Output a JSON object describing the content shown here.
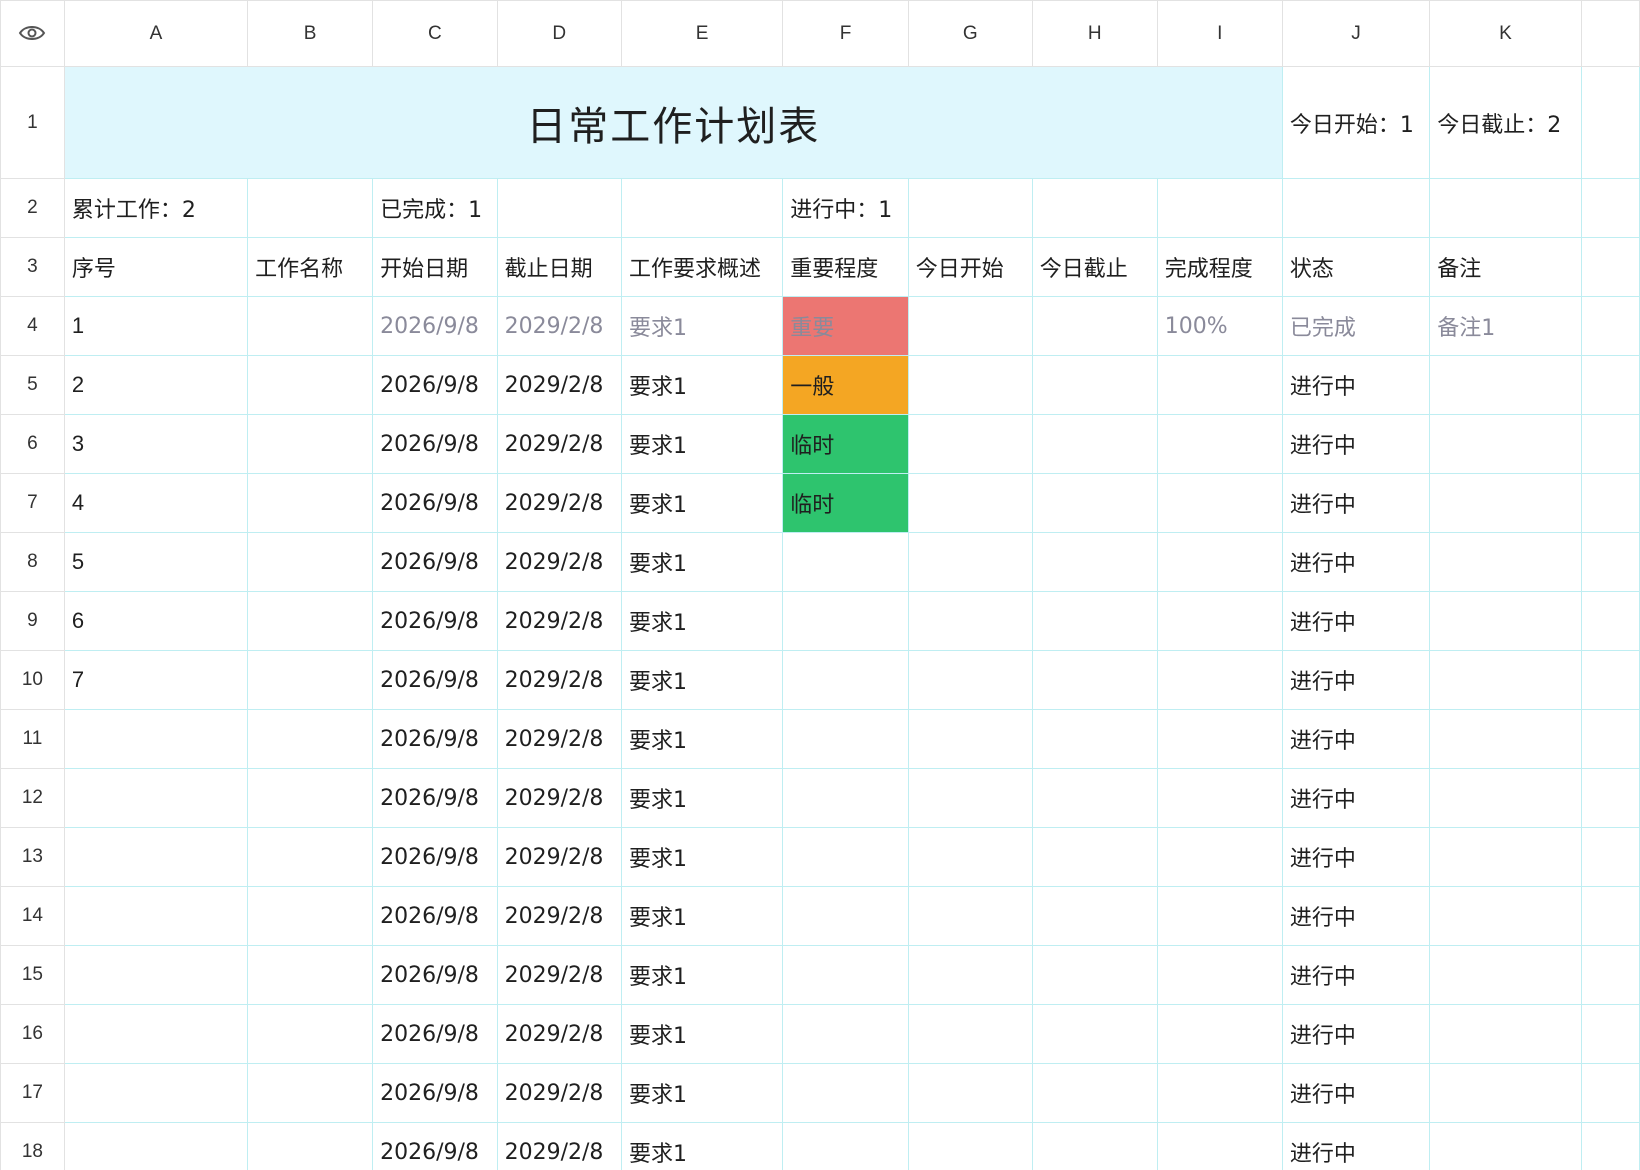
{
  "columns": [
    "A",
    "B",
    "C",
    "D",
    "E",
    "F",
    "G",
    "H",
    "I",
    "J",
    "K"
  ],
  "title": "日常工作计划表",
  "today_start": "今日开始：1",
  "today_due": "今日截止：2",
  "summary": {
    "total": "累计工作：2",
    "done": "已完成：1",
    "in_progress": "进行中：1"
  },
  "headers": [
    "序号",
    "工作名称",
    "开始日期",
    "截止日期",
    "工作要求概述",
    "重要程度",
    "今日开始",
    "今日截止",
    "完成程度",
    "状态",
    "备注"
  ],
  "colors": {
    "important": "#ec7672",
    "normal": "#f4a623",
    "temporary": "#2ec46e",
    "title_bg": "#dff7fd",
    "grid": "#bfeef2"
  },
  "rows": [
    {
      "n": "4",
      "seq": "1",
      "start": "2026/9/8",
      "due": "2029/2/8",
      "req": "要求1",
      "level": "重要",
      "level_color": "#ec7672",
      "progress": "100%",
      "status": "已完成",
      "note": "备注1",
      "done": true
    },
    {
      "n": "5",
      "seq": "2",
      "start": "2026/9/8",
      "due": "2029/2/8",
      "req": "要求1",
      "level": "一般",
      "level_color": "#f4a623",
      "progress": "",
      "status": "进行中",
      "note": ""
    },
    {
      "n": "6",
      "seq": "3",
      "start": "2026/9/8",
      "due": "2029/2/8",
      "req": "要求1",
      "level": "临时",
      "level_color": "#2ec46e",
      "progress": "",
      "status": "进行中",
      "note": ""
    },
    {
      "n": "7",
      "seq": "4",
      "start": "2026/9/8",
      "due": "2029/2/8",
      "req": "要求1",
      "level": "临时",
      "level_color": "#2ec46e",
      "progress": "",
      "status": "进行中",
      "note": ""
    },
    {
      "n": "8",
      "seq": "5",
      "start": "2026/9/8",
      "due": "2029/2/8",
      "req": "要求1",
      "level": "",
      "level_color": "",
      "progress": "",
      "status": "进行中",
      "note": ""
    },
    {
      "n": "9",
      "seq": "6",
      "start": "2026/9/8",
      "due": "2029/2/8",
      "req": "要求1",
      "level": "",
      "level_color": "",
      "progress": "",
      "status": "进行中",
      "note": ""
    },
    {
      "n": "10",
      "seq": "7",
      "start": "2026/9/8",
      "due": "2029/2/8",
      "req": "要求1",
      "level": "",
      "level_color": "",
      "progress": "",
      "status": "进行中",
      "note": ""
    },
    {
      "n": "11",
      "seq": "",
      "start": "2026/9/8",
      "due": "2029/2/8",
      "req": "要求1",
      "level": "",
      "level_color": "",
      "progress": "",
      "status": "进行中",
      "note": ""
    },
    {
      "n": "12",
      "seq": "",
      "start": "2026/9/8",
      "due": "2029/2/8",
      "req": "要求1",
      "level": "",
      "level_color": "",
      "progress": "",
      "status": "进行中",
      "note": ""
    },
    {
      "n": "13",
      "seq": "",
      "start": "2026/9/8",
      "due": "2029/2/8",
      "req": "要求1",
      "level": "",
      "level_color": "",
      "progress": "",
      "status": "进行中",
      "note": ""
    },
    {
      "n": "14",
      "seq": "",
      "start": "2026/9/8",
      "due": "2029/2/8",
      "req": "要求1",
      "level": "",
      "level_color": "",
      "progress": "",
      "status": "进行中",
      "note": ""
    },
    {
      "n": "15",
      "seq": "",
      "start": "2026/9/8",
      "due": "2029/2/8",
      "req": "要求1",
      "level": "",
      "level_color": "",
      "progress": "",
      "status": "进行中",
      "note": ""
    },
    {
      "n": "16",
      "seq": "",
      "start": "2026/9/8",
      "due": "2029/2/8",
      "req": "要求1",
      "level": "",
      "level_color": "",
      "progress": "",
      "status": "进行中",
      "note": ""
    },
    {
      "n": "17",
      "seq": "",
      "start": "2026/9/8",
      "due": "2029/2/8",
      "req": "要求1",
      "level": "",
      "level_color": "",
      "progress": "",
      "status": "进行中",
      "note": ""
    },
    {
      "n": "18",
      "seq": "",
      "start": "2026/9/8",
      "due": "2029/2/8",
      "req": "要求1",
      "level": "",
      "level_color": "",
      "progress": "",
      "status": "进行中",
      "note": ""
    }
  ]
}
